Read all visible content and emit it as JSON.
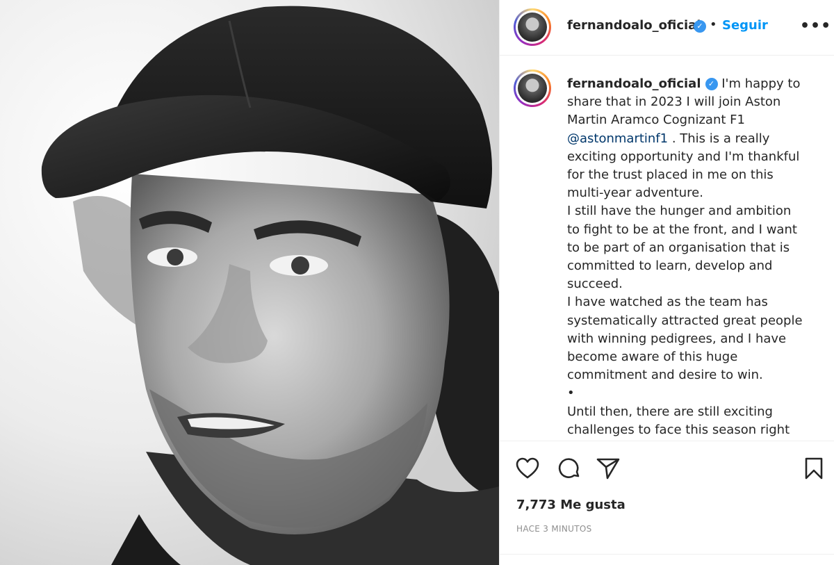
{
  "post": {
    "author": "fernandoalo_oficial",
    "follow_label": "Seguir",
    "more_glyph": "•••",
    "separator_dot": "•",
    "verified_glyph": "✓"
  },
  "caption": {
    "username": "fernandoalo_oficial",
    "text_before_mention": " I'm happy to share that in 2023 I will join Aston Martin Aramco Cognizant F1 ",
    "mention": "@astonmartinf1",
    "text_after_mention": " . This is a really exciting opportunity and I'm thankful for the trust placed in me on this multi-year adventure.",
    "paragraph_2": "I still have the hunger and ambition to fight to be at the front, and I want to be part of an organisation that is committed to learn, develop and succeed.",
    "paragraph_3": "I have watched as the team has systematically attracted great people with winning pedigrees, and I have become aware of this huge commitment and desire to win.",
    "bullet": "•",
    "paragraph_4": "Until then, there are still exciting challenges to face this season right"
  },
  "actions": {
    "icons": [
      "heart-icon",
      "comment-icon",
      "share-icon",
      "bookmark-icon"
    ]
  },
  "likes_text": "7,773 Me gusta",
  "time_ago": "HACE 3 MINUTOS",
  "colors": {
    "follow_blue": "#0095f6",
    "verified_blue": "#3897f0",
    "mention_blue": "#00376b",
    "text": "#262626",
    "muted": "#8e8e8e"
  }
}
